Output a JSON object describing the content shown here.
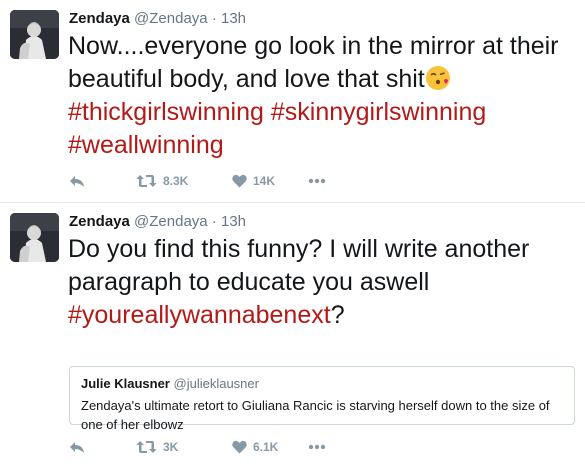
{
  "tweets": [
    {
      "author_name": "Zendaya",
      "handle": "@Zendaya",
      "separator": "·",
      "time": "13h",
      "text_parts": [
        "Now....everyone go look in the mirror at their beautiful body, and love that shit"
      ],
      "hashtags": [
        "#thickgirlswinning",
        "#skinnygirlswinning",
        "#weallwinning"
      ],
      "emoji_icon": "kiss-face-emoji-icon",
      "retweets": "8.3K",
      "likes": "14K"
    },
    {
      "author_name": "Zendaya",
      "handle": "@Zendaya",
      "separator": "·",
      "time": "13h",
      "text_parts": [
        "Do you find this funny? I will write another paragraph to educate you aswell",
        "?"
      ],
      "hashtags": [
        "#youreallywannabenext"
      ],
      "quote": {
        "author_name": "Julie Klausner",
        "handle": "@julieklausner",
        "text": "Zendaya's ultimate retort to Giuliana Rancic is starving herself down to the size of one of her elbowz"
      },
      "retweets": "3K",
      "likes": "6.1K"
    }
  ],
  "icons": {
    "reply": "reply-icon",
    "retweet": "retweet-icon",
    "like": "heart-icon",
    "more": "more-icon"
  },
  "colors": {
    "hashtag": "#b31917",
    "action_icon": "#8899a6",
    "secondary_text": "#657786"
  }
}
